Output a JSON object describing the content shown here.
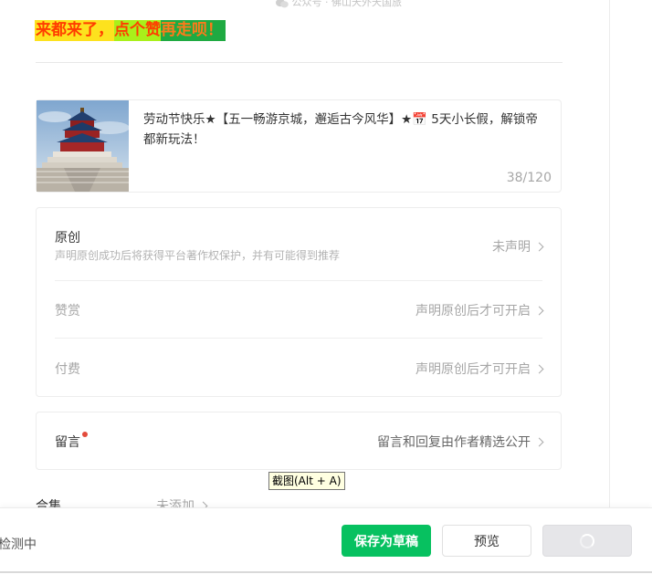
{
  "header": {
    "account_note": "公众号 · 佛山天外天国旅",
    "promo": [
      "来都来了，",
      "点个赞",
      "再走呗！"
    ]
  },
  "article": {
    "title": "劳动节快乐★【五一畅游京城，邂逅古今风华】★📅 5天小长假，解锁帝都新玩法！",
    "counter": "38/120"
  },
  "settings": {
    "original": {
      "label": "原创",
      "desc": "声明原创成功后将获得平台著作权保护，并有可能得到推荐",
      "value": "未声明"
    },
    "reward": {
      "label": "赞赏",
      "value": "声明原创后才可开启"
    },
    "paid": {
      "label": "付费",
      "value": "声明原创后才可开启"
    }
  },
  "comments": {
    "label": "留言",
    "value": "留言和回复由作者精选公开"
  },
  "collection": {
    "label": "合集",
    "value": "未添加"
  },
  "tooltip": "截图(Alt + A)",
  "footer": {
    "status": "检测中",
    "save_label": "保存为草稿",
    "preview_label": "预览"
  },
  "colors": {
    "accent": "#07c160",
    "badge": "#e34b3b"
  }
}
